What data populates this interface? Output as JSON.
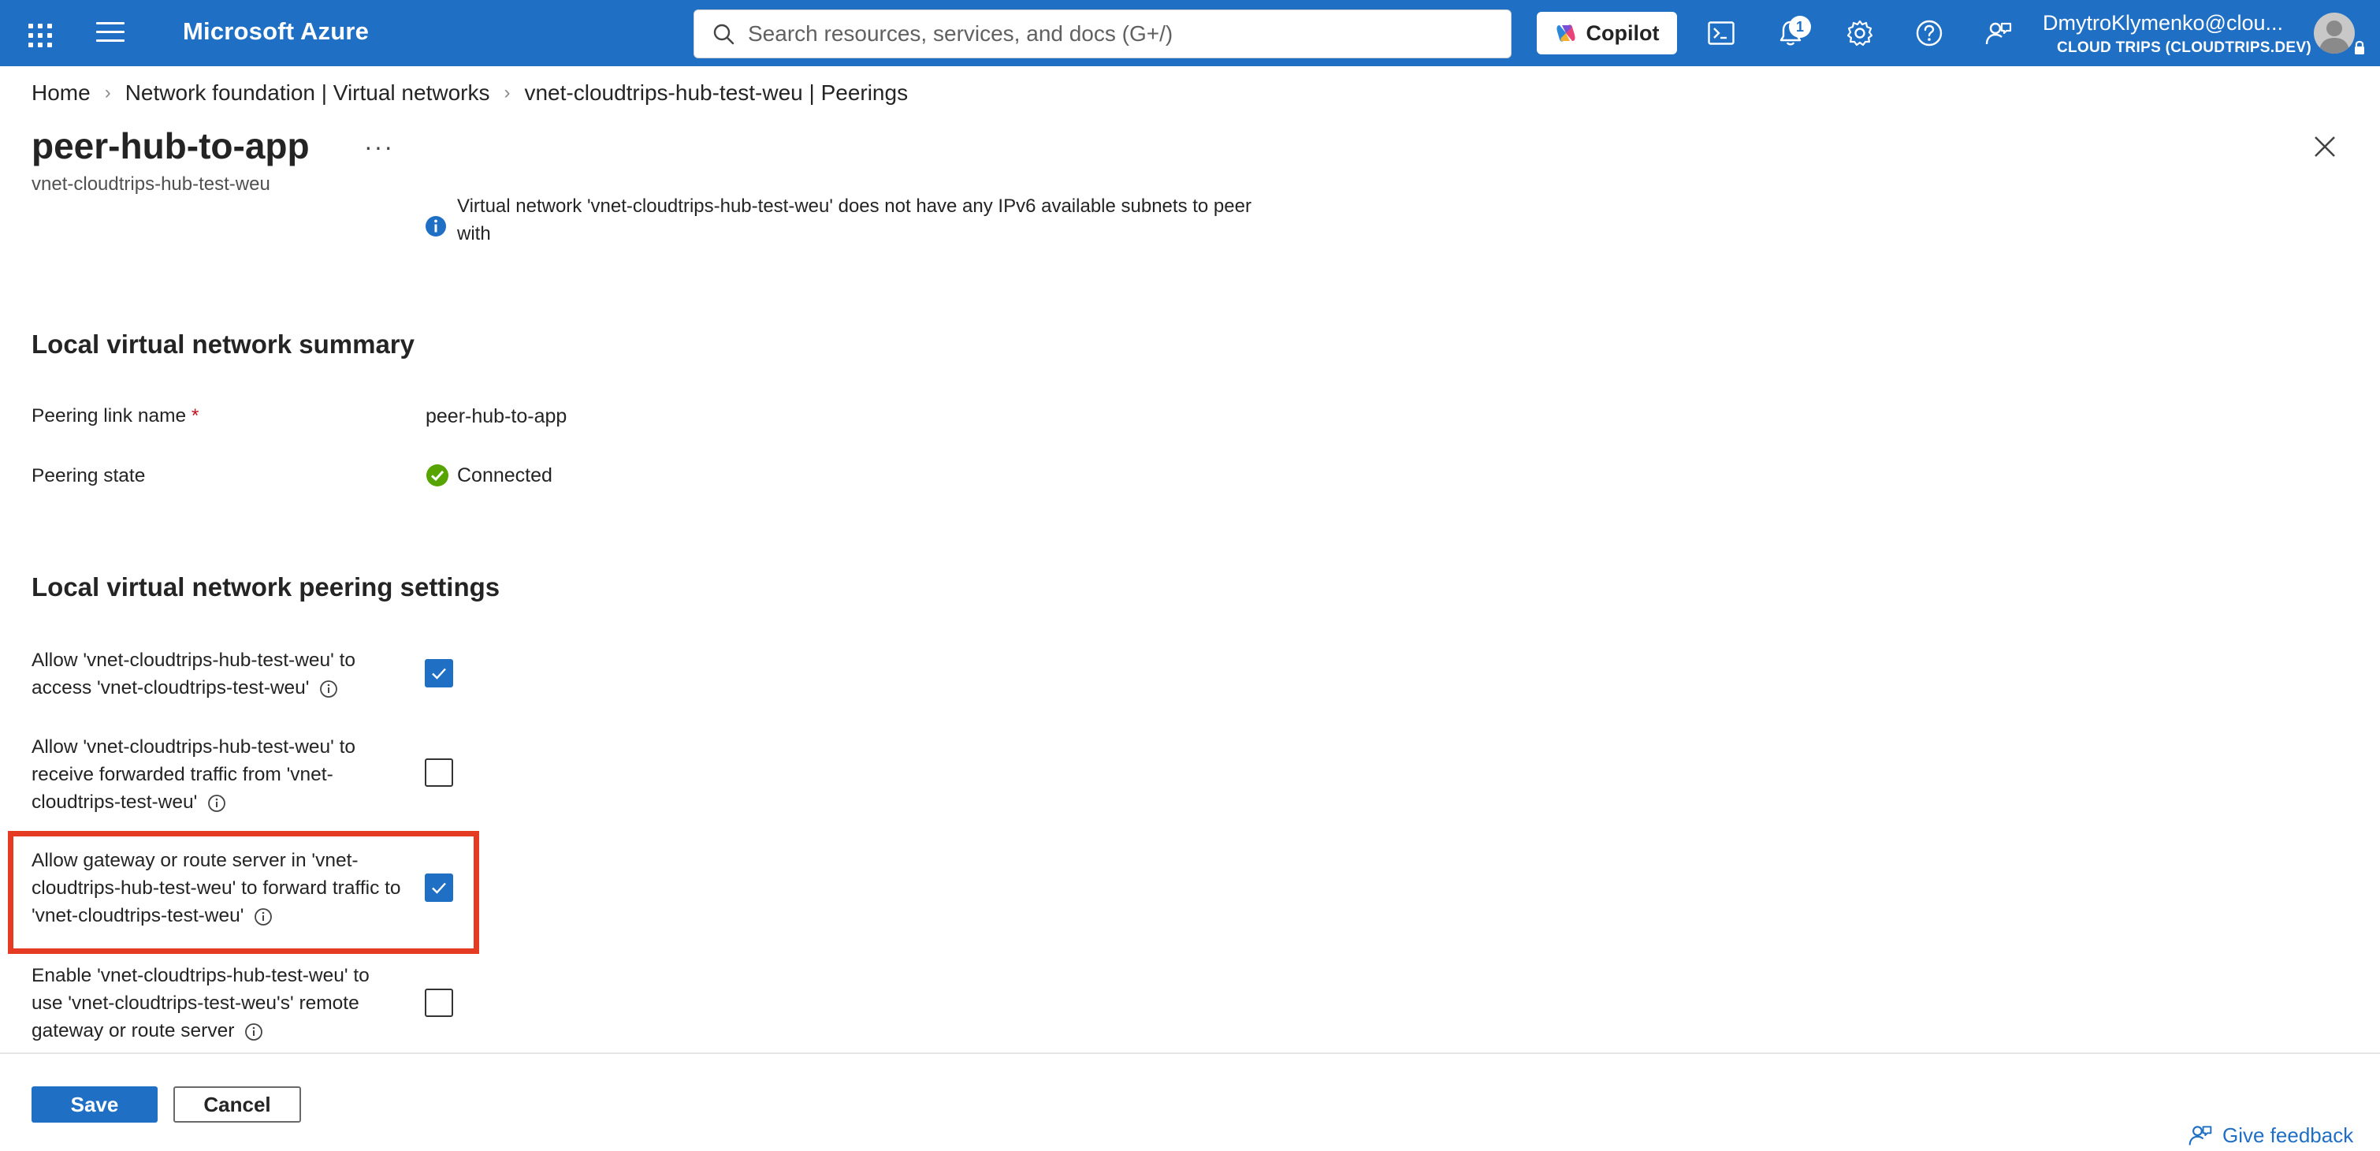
{
  "topbar": {
    "brand": "Microsoft Azure",
    "search_placeholder": "Search resources, services, and docs (G+/)",
    "copilot_label": "Copilot",
    "notification_count": "1",
    "user_name": "DmytroKlymenko@clou...",
    "user_tenant": "CLOUD TRIPS (CLOUDTRIPS.DEV)",
    "icons": [
      "app-launcher-icon",
      "hamburger-menu-icon",
      "search-icon",
      "copilot-icon",
      "cloud-shell-icon",
      "bell-icon",
      "gear-icon",
      "help-icon",
      "feedback-icon",
      "avatar-icon",
      "lock-icon"
    ],
    "colors": {
      "bar": "#1f6fc5"
    }
  },
  "breadcrumb": {
    "items": [
      "Home",
      "Network foundation | Virtual networks",
      "vnet-cloudtrips-hub-test-weu | Peerings"
    ]
  },
  "page": {
    "title": "peer-hub-to-app",
    "more_label": "···",
    "subtitle": "vnet-cloudtrips-hub-test-weu"
  },
  "info_banner": {
    "text": "Virtual network 'vnet-cloudtrips-hub-test-weu' does not have any IPv6 available subnets to peer with"
  },
  "summary": {
    "heading": "Local virtual network summary",
    "peering_link_name_label": "Peering link name",
    "required_mark": "*",
    "peering_link_name_value": "peer-hub-to-app",
    "peering_state_label": "Peering state",
    "peering_state_value": "Connected"
  },
  "settings": {
    "heading": "Local virtual network peering settings",
    "items": [
      {
        "label": "Allow 'vnet-cloudtrips-hub-test-weu' to access 'vnet-cloudtrips-test-weu'",
        "checked": true
      },
      {
        "label": "Allow 'vnet-cloudtrips-hub-test-weu' to receive forwarded traffic from 'vnet-cloudtrips-test-weu'",
        "checked": false
      },
      {
        "label": "Allow gateway or route server in 'vnet-cloudtrips-hub-test-weu' to forward traffic to 'vnet-cloudtrips-test-weu'",
        "checked": true,
        "highlighted": true
      },
      {
        "label": "Enable 'vnet-cloudtrips-hub-test-weu' to use 'vnet-cloudtrips-test-weu's' remote gateway or route server",
        "checked": false
      }
    ]
  },
  "footer": {
    "save_label": "Save",
    "cancel_label": "Cancel",
    "feedback_label": "Give feedback"
  },
  "colors": {
    "accent": "#1f6fc5",
    "success": "#57a300",
    "highlight": "#e43b22",
    "required": "#c50f1f"
  }
}
